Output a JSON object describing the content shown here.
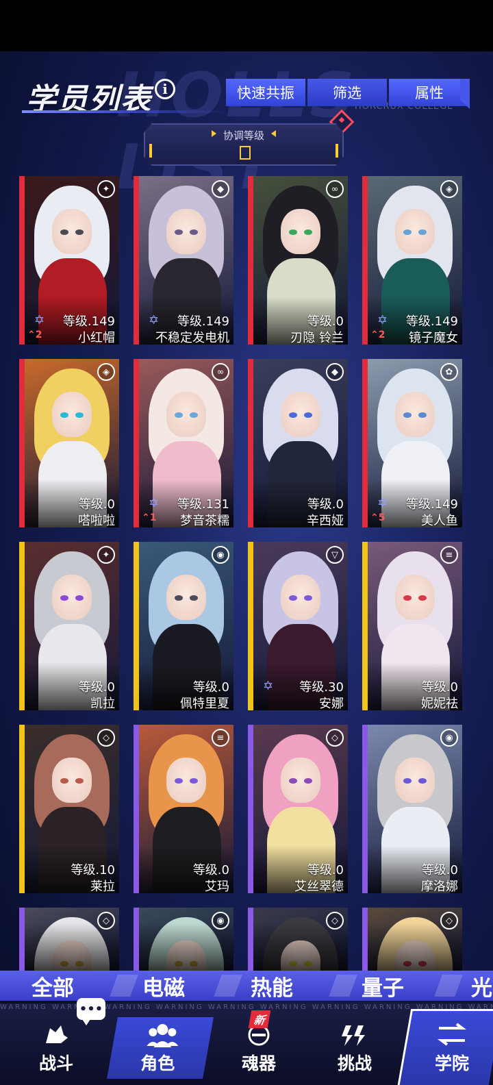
{
  "header": {
    "title": "学员列表",
    "background_word": "HOLLS LIST",
    "college_text": "HORCRUX COLLEGE",
    "buttons": [
      "快速共振",
      "筛选",
      "属性"
    ]
  },
  "coordination": {
    "label": "协调等级",
    "value": ""
  },
  "cards": [
    {
      "level": "等级.149",
      "name": "小红帽",
      "rank": "2",
      "stripe": "#e22c3c",
      "hair": "#e9ecf2",
      "outfit": "#b21c24",
      "bg": "#3a1a1a",
      "eye": "#4a4a55",
      "element": "✦",
      "has_star": true
    },
    {
      "level": "等级.149",
      "name": "不稳定发电机",
      "rank": "",
      "stripe": "#e22c3c",
      "hair": "#c8c0d8",
      "outfit": "#2a2630",
      "bg": "#7a6f86",
      "eye": "#6a5a88",
      "element": "◆",
      "has_star": true
    },
    {
      "level": "等级.0",
      "name": "刃隐 铃兰",
      "rank": "",
      "stripe": "#e22c3c",
      "hair": "#1e1e24",
      "outfit": "#d8dcc8",
      "bg": "#46503a",
      "eye": "#3aa85a",
      "element": "∞",
      "has_star": false
    },
    {
      "level": "等级.149",
      "name": "镜子魔女",
      "rank": "2",
      "stripe": "#e22c3c",
      "hair": "#e2e4ee",
      "outfit": "#1a5c58",
      "bg": "#5a6a74",
      "eye": "#6aa2d8",
      "element": "◈",
      "has_star": true
    },
    {
      "level": "等级.0",
      "name": "嗒啦啦",
      "rank": "",
      "stripe": "#e22c3c",
      "hair": "#f0d060",
      "outfit": "#eeeef2",
      "bg": "#c96a2a",
      "eye": "#2ab8d8",
      "element": "◈",
      "has_star": false
    },
    {
      "level": "等级.131",
      "name": "梦音茶糯",
      "rank": "1",
      "stripe": "#e22c3c",
      "hair": "#f4e8e4",
      "outfit": "#f0bccc",
      "bg": "#9a5a5a",
      "eye": "#6aa8d8",
      "element": "∞",
      "has_star": true
    },
    {
      "level": "等级.0",
      "name": "辛西娅",
      "rank": "",
      "stripe": "#e22c3c",
      "hair": "#d8dcee",
      "outfit": "#22263a",
      "bg": "#3a3e5a",
      "eye": "#4a6ad8",
      "element": "◆",
      "has_star": false
    },
    {
      "level": "等级.149",
      "name": "美人鱼",
      "rank": "5",
      "stripe": "#e22c3c",
      "hair": "#dce4f0",
      "outfit": "#eef0f6",
      "bg": "#8c9cae",
      "eye": "#5a8ad0",
      "element": "✿",
      "has_star": true
    },
    {
      "level": "等级.0",
      "name": "凯拉",
      "rank": "",
      "stripe": "#f2c418",
      "hair": "#c8cad2",
      "outfit": "#e8e8ec",
      "bg": "#5a2e2e",
      "eye": "#8a4ad8",
      "element": "✦",
      "has_star": false
    },
    {
      "level": "等级.0",
      "name": "佩特里夏",
      "rank": "",
      "stripe": "#f2c418",
      "hair": "#aac8e4",
      "outfit": "#1a1a22",
      "bg": "#3a5a7a",
      "eye": "#4a4a58",
      "element": "◉",
      "has_star": false
    },
    {
      "level": "等级.30",
      "name": "安娜",
      "rank": "",
      "stripe": "#f2c418",
      "hair": "#c8c4e6",
      "outfit": "#3a1a2e",
      "bg": "#4a3a5a",
      "eye": "#7a5ad8",
      "element": "▽",
      "has_star": true
    },
    {
      "level": "等级.0",
      "name": "妮妮祛",
      "rank": "",
      "stripe": "#f2c418",
      "hair": "#e8e0ec",
      "outfit": "#f0e6ee",
      "bg": "#7a5a7a",
      "eye": "#d83a4a",
      "element": "≡",
      "has_star": false
    },
    {
      "level": "等级.10",
      "name": "莱拉",
      "rank": "",
      "stripe": "#f2c418",
      "hair": "#a86a5a",
      "outfit": "#2a2226",
      "bg": "#3a2e2a",
      "eye": "#b85a4a",
      "element": "◇",
      "has_star": false
    },
    {
      "level": "等级.0",
      "name": "艾玛",
      "rank": "",
      "stripe": "#8a5ae6",
      "hair": "#e8944a",
      "outfit": "#1e1e22",
      "bg": "#b85a3a",
      "eye": "#7a5ad8",
      "element": "≡",
      "has_star": false
    },
    {
      "level": "等级.0",
      "name": "艾丝翠德",
      "rank": "",
      "stripe": "#8a5ae6",
      "hair": "#f0a0c0",
      "outfit": "#f2e0a0",
      "bg": "#5a3a4e",
      "eye": "#8a4ab8",
      "element": "◇",
      "has_star": false
    },
    {
      "level": "等级.0",
      "name": "摩洛娜",
      "rank": "",
      "stripe": "#8a5ae6",
      "hair": "#c8c8cc",
      "outfit": "#eaeef4",
      "bg": "#7a8aae",
      "eye": "#6a5ad8",
      "element": "◉",
      "has_star": false
    },
    {
      "level": "",
      "name": "",
      "rank": "",
      "stripe": "#8a5ae6",
      "hair": "#e6e6ea",
      "outfit": "#2a2a30",
      "bg": "#4a4a58",
      "eye": "#d8a83a",
      "element": "◇",
      "has_star": false
    },
    {
      "level": "",
      "name": "",
      "rank": "",
      "stripe": "#8a5ae6",
      "hair": "#bcd8d0",
      "outfit": "#2a2a30",
      "bg": "#3a4a58",
      "eye": "#d8a83a",
      "element": "◉",
      "has_star": false
    },
    {
      "level": "",
      "name": "",
      "rank": "",
      "stripe": "#8a5ae6",
      "hair": "#3a3a40",
      "outfit": "#2a2a30",
      "bg": "#3a3a4a",
      "eye": "#d8d83a",
      "element": "◇",
      "has_star": false
    },
    {
      "level": "",
      "name": "",
      "rank": "",
      "stripe": "#8a5ae6",
      "hair": "#f2d49a",
      "outfit": "#2a2a30",
      "bg": "#5a4a3a",
      "eye": "#d83a4a",
      "element": "◇",
      "has_star": false
    }
  ],
  "filter_tabs": [
    "全部",
    "电磁",
    "热能",
    "量子",
    "光"
  ],
  "nav": {
    "warning_text": "WARNING WARNING WARNING WARNING WARNING WARNING WARNING WARNING WARNING WARNING",
    "items": [
      "战斗",
      "角色",
      "魂器",
      "挑战",
      "学院"
    ],
    "new_badge": "新",
    "chat_icon": "•••"
  },
  "colors": {
    "accent": "#4758e8",
    "red_stripe": "#e22c3c",
    "yellow_stripe": "#f2c418",
    "purple_stripe": "#8a5ae6",
    "gold": "#ffcc33"
  }
}
